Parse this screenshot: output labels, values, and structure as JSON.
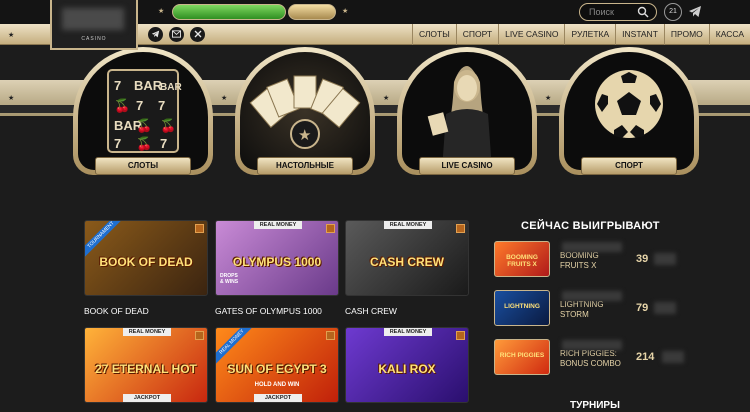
{
  "header": {
    "logo_caption": "CASINO",
    "search_placeholder": "Поиск",
    "age_badge": "21"
  },
  "nav": {
    "items": [
      "СЛОТЫ",
      "СПОРТ",
      "LIVE CASINO",
      "РУЛЕТКА",
      "INSTANT",
      "ПРОМО",
      "КАССА"
    ]
  },
  "categories": [
    {
      "label": "СЛОТЫ",
      "icon": "slot-machine-icon"
    },
    {
      "label": "НАСТОЛЬНЫЕ",
      "icon": "cards-icon"
    },
    {
      "label": "LIVE CASINO",
      "icon": "dealer-icon"
    },
    {
      "label": "СПОРТ",
      "icon": "soccer-ball-icon"
    }
  ],
  "games": [
    {
      "name": "BOOK OF DEAD",
      "art": "BOOK OF DEAD",
      "ribbon": "TOURNAMENT",
      "bg": [
        "#8a5a1a",
        "#3b2410"
      ]
    },
    {
      "name": "GATES OF OLYMPUS 1000",
      "art": "OLYMPUS 1000",
      "badge": "REAL MONEY",
      "tag": "DROPS & WINS",
      "bg": [
        "#c98bd6",
        "#6a3a8a"
      ]
    },
    {
      "name": "CASH CREW",
      "art": "CASH CREW",
      "badge": "REAL MONEY",
      "bg": [
        "#5a5a5a",
        "#1a1a1a"
      ]
    },
    {
      "name": "",
      "art": "27 ETERNAL HOT",
      "badge": "REAL MONEY",
      "jackpot": "JACKPOT",
      "bg": [
        "#ffb33a",
        "#c8270f"
      ]
    },
    {
      "name": "",
      "art": "SUN OF EGYPT 3",
      "sub": "HOLD AND WIN",
      "ribbon": "REAL MONEY",
      "jackpot": "JACKPOT",
      "bg": [
        "#ff8a1a",
        "#c0200a"
      ]
    },
    {
      "name": "",
      "art": "KALI ROX",
      "badge": "REAL MONEY",
      "bg": [
        "#6e3ad0",
        "#2a0f6e"
      ]
    }
  ],
  "winners": {
    "title": "СЕЙЧАС ВЫИГРЫВАЮТ",
    "items": [
      {
        "game_line1": "BOOMING",
        "game_line2": "FRUITS X",
        "amount": "39",
        "thumb_text": "BOOMING FRUITS X"
      },
      {
        "game_line1": "LIGHTNING",
        "game_line2": "STORM",
        "amount": "79",
        "thumb_text": "LIGHTNING"
      },
      {
        "game_line1": "RICH PIGGIES:",
        "game_line2": "BONUS COMBO",
        "amount": "214",
        "thumb_text": "RICH PIGGIES"
      }
    ]
  },
  "tournaments_title": "ТУРНИРЫ",
  "colors": {
    "gold": "#c9b58c",
    "dark": "#1c1c1c"
  }
}
